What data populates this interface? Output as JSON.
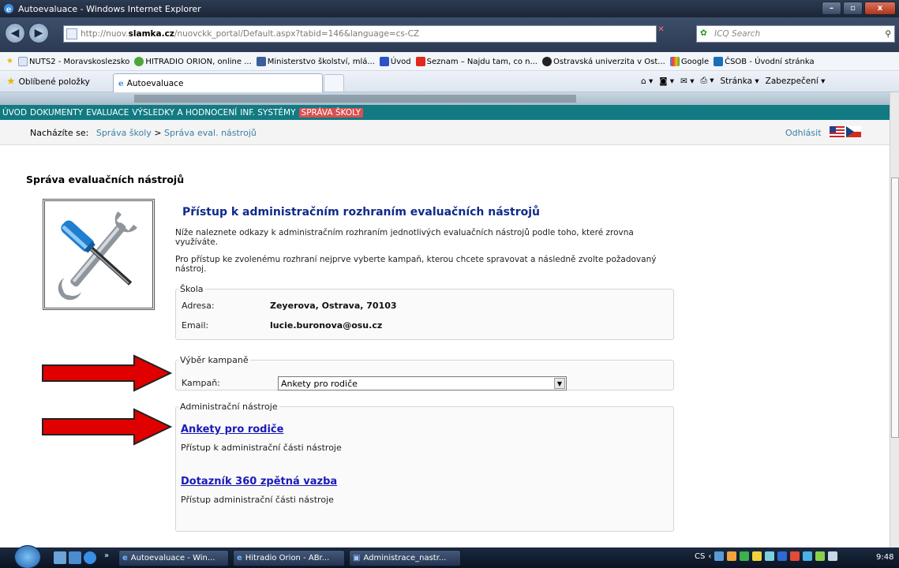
{
  "window": {
    "title": "Autoevaluace - Windows Internet Explorer",
    "minimize": "–",
    "maximize": "▫",
    "close": "x"
  },
  "address": {
    "prefix": "http://nuov.",
    "domain": "slamka.cz",
    "suffix": "/nuovckk_portal/Default.aspx?tabid=146&language=cs-CZ"
  },
  "search": {
    "placeholder": "ICQ Search"
  },
  "favorites_bar": [
    "NUTS2 - Moravskoslezsko",
    "HITRADIO ORION, online ...",
    "Ministerstvo školství, mlá...",
    "Úvod",
    "Seznam – Najdu tam, co n...",
    "Ostravská univerzita v Ost...",
    "Google",
    "ČSOB - Úvodní stránka"
  ],
  "tabbar": {
    "favorites_label": "Oblíbené položky",
    "tab_label": "Autoevaluace",
    "page_menu": "Stránka ▾",
    "safety_menu": "Zabezpečení ▾"
  },
  "site_menu": {
    "items": [
      "ÚVOD",
      "DOKUMENTY",
      "EVALUACE",
      "VÝSLEDKY A HODNOCENÍ",
      "INF. SYSTÉMY"
    ],
    "active": "SPRÁVA ŠKOLY"
  },
  "breadcrumb": {
    "prefix": "Nacházíte se:",
    "item1": "Správa školy",
    "separator": ">",
    "item2": "Správa eval. nástrojů",
    "logout": "Odhlásit"
  },
  "page": {
    "title": "Správa evaluačních nástrojů",
    "heading": "Přístup k administračním rozhraním evaluačních nástrojů",
    "para1": "Níže naleznete odkazy k administračním rozhraním jednotlivých evaluačních nástrojů podle toho, které zrovna využíváte.",
    "para2": "Pro přístup ke zvolenému rozhraní nejprve vyberte kampaň, kterou chcete spravovat a následně zvolte požadovaný nástroj."
  },
  "school": {
    "legend": "Škola",
    "address_label": "Adresa:",
    "address_value": "Zeyerova, Ostrava, 70103",
    "email_label": "Email:",
    "email_value": "lucie.buronova@osu.cz"
  },
  "campaign": {
    "legend": "Výběr kampaně",
    "label": "Kampaň:",
    "selected": "Ankety pro rodiče"
  },
  "tools": {
    "legend": "Administrační nástroje",
    "items": [
      {
        "name": "Ankety pro rodiče",
        "desc": "Přístup k administrační části nástroje"
      },
      {
        "name": "Dotazník 360 zpětná vazba",
        "desc": "Přístup administrační části nástroje"
      }
    ]
  },
  "taskbar": {
    "tasks": [
      "Autoevaluace - Win...",
      "Hitradio Orion - ABr...",
      "Administrace_nastr..."
    ],
    "lang": "CS",
    "clock": "9:48"
  },
  "colors": {
    "menu_bg": "#127a82",
    "active_menu": "#d94f4f",
    "heading": "#102a8c",
    "link": "#1a1ab8",
    "arrow": "#e00000"
  }
}
